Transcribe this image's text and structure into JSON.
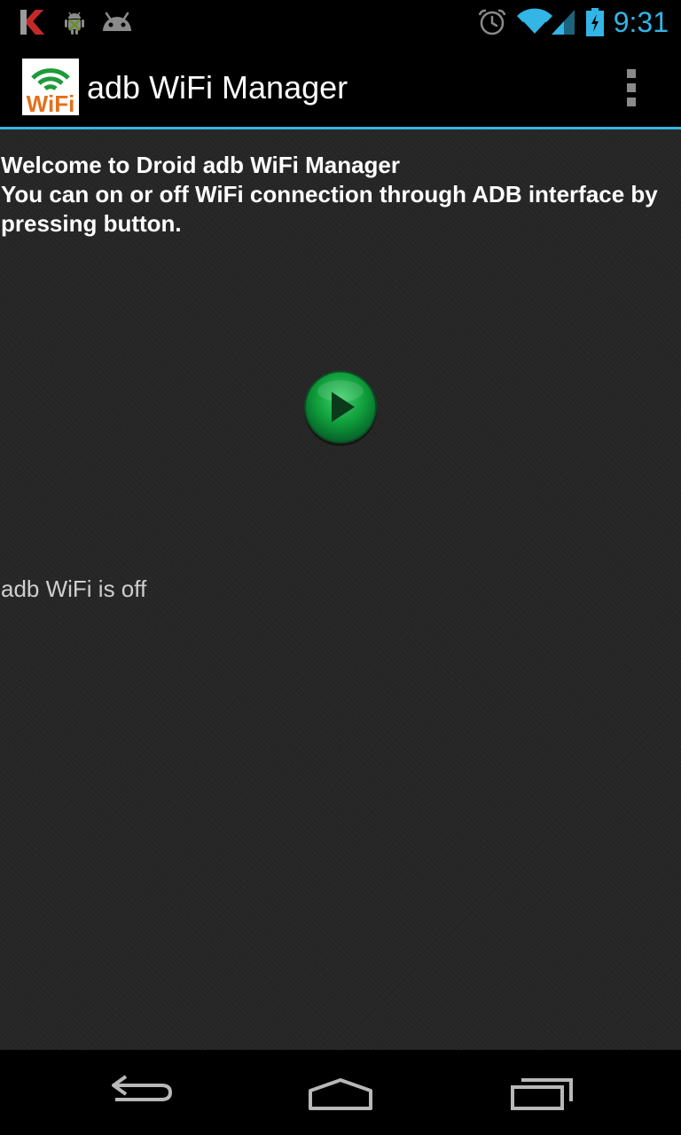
{
  "status_bar": {
    "time": "9:31",
    "icons": [
      "kaspersky-icon",
      "android-debug-icon",
      "android-icon",
      "alarm-icon",
      "wifi-icon",
      "signal-icon",
      "battery-charging-icon"
    ],
    "accent_color": "#33b5e5"
  },
  "action_bar": {
    "title": "adb WiFi Manager",
    "logo_text": "WiFi",
    "overflow_icon": "overflow-menu-icon"
  },
  "content": {
    "welcome_line1": "Welcome to Droid adb WiFi Manager",
    "welcome_line2": "You can on or off WiFi connection through ADB interface by pressing button.",
    "play_button_icon": "play-icon",
    "status": "adb WiFi is off"
  },
  "nav_bar": {
    "icons": [
      "back-icon",
      "home-icon",
      "recent-apps-icon"
    ]
  }
}
